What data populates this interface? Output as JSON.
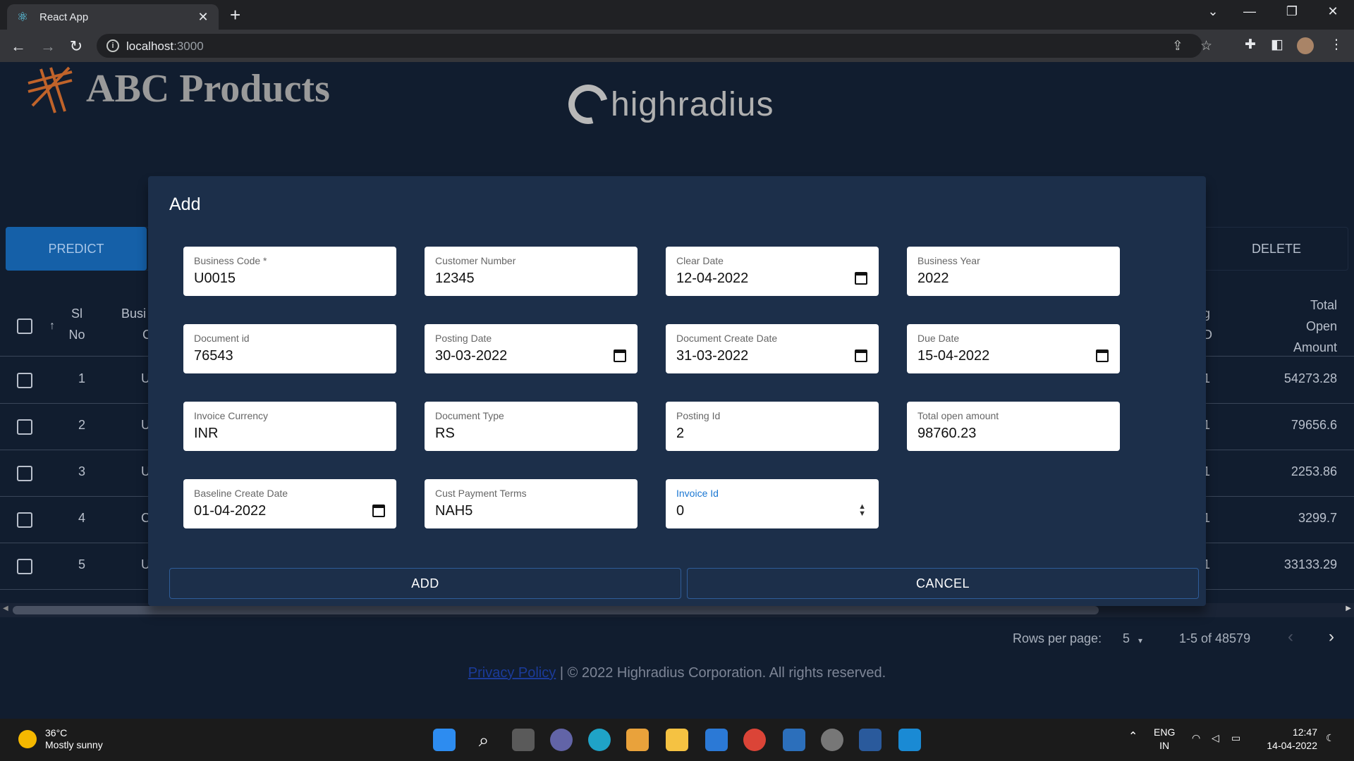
{
  "browser": {
    "tab_title": "React App",
    "close_symbol": "✕",
    "new_tab_symbol": "+",
    "url_host": "localhost",
    "url_port": ":3000"
  },
  "app": {
    "brand": "ABC Products",
    "partner_logo": "highradius",
    "predict_label": "PREDICT",
    "delete_label": "DELETE"
  },
  "grid": {
    "headers": {
      "sl_no_line1": "Sl",
      "sl_no_line2": "No",
      "business_partial": "Busi",
      "business_partial_2": "C",
      "posting_partial_1": "g",
      "posting_partial_2": "D",
      "total_line1": "Total",
      "total_line2": "Open",
      "total_line3": "Amount"
    },
    "rows": [
      {
        "sl": "1",
        "col2": "U",
        "posting": "1",
        "amount": "54273.28"
      },
      {
        "sl": "2",
        "col2": "U",
        "posting": "1",
        "amount": "79656.6"
      },
      {
        "sl": "3",
        "col2": "U",
        "posting": "1",
        "amount": "2253.86"
      },
      {
        "sl": "4",
        "col2": "C",
        "posting": "1",
        "amount": "3299.7"
      },
      {
        "sl": "5",
        "col2": "U",
        "posting": "1",
        "amount": "33133.29"
      }
    ]
  },
  "pagination": {
    "rows_per_page_label": "Rows per page:",
    "rows_per_page_value": "5",
    "range": "1-5 of 48579"
  },
  "footer": {
    "privacy_link": "Privacy Policy",
    "text": "| © 2022 Highradius Corporation. All rights reserved."
  },
  "modal": {
    "title": "Add",
    "fields": {
      "business_code": {
        "label": "Business Code *",
        "value": "U0015"
      },
      "customer_number": {
        "label": "Customer Number",
        "value": "12345"
      },
      "clear_date": {
        "label": "Clear Date",
        "value": "12-04-2022"
      },
      "business_year": {
        "label": "Business Year",
        "value": "2022"
      },
      "document_id": {
        "label": "Document id",
        "value": "76543"
      },
      "posting_date": {
        "label": "Posting Date",
        "value": "30-03-2022"
      },
      "document_create_date": {
        "label": "Document Create Date",
        "value": "31-03-2022"
      },
      "due_date": {
        "label": "Due Date",
        "value": "15-04-2022"
      },
      "invoice_currency": {
        "label": "Invoice Currency",
        "value": "INR"
      },
      "document_type": {
        "label": "Document Type",
        "value": "RS"
      },
      "posting_id": {
        "label": "Posting Id",
        "value": "2"
      },
      "total_open_amount": {
        "label": "Total open amount",
        "value": "98760.23"
      },
      "baseline_create_date": {
        "label": "Baseline Create Date",
        "value": "01-04-2022"
      },
      "cust_payment_terms": {
        "label": "Cust Payment Terms",
        "value": "NAH5"
      },
      "invoice_id": {
        "label": "Invoice Id",
        "value": "0"
      }
    },
    "add_label": "ADD",
    "cancel_label": "CANCEL"
  },
  "taskbar": {
    "temperature": "36°C",
    "weather": "Mostly sunny",
    "lang_line1": "ENG",
    "lang_line2": "IN",
    "time": "12:47",
    "date": "14-04-2022"
  },
  "colors": {
    "page_bg": "#111d2f",
    "modal_bg": "#1c2f4a",
    "predict": "#1560a8",
    "focus_label": "#1976d2"
  }
}
